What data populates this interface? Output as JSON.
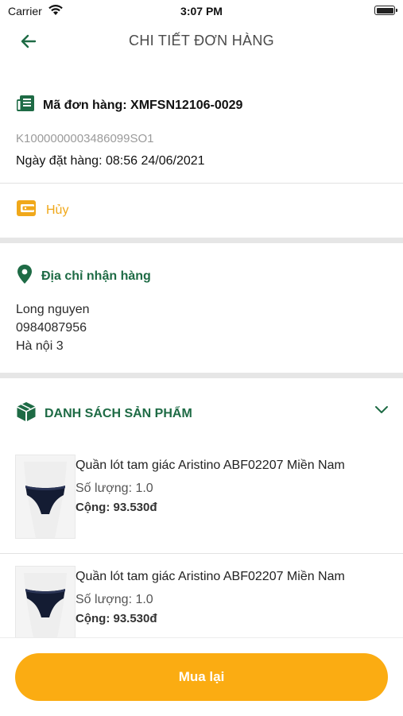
{
  "status_bar": {
    "carrier": "Carrier",
    "time": "3:07 PM"
  },
  "header": {
    "title": "CHI TIẾT ĐƠN HÀNG"
  },
  "order": {
    "code_label": "Mã đơn hàng: XMFSN12106-0029",
    "sub_code": "K1000000003486099SO1",
    "date_label": "Ngày đặt hàng: 08:56 24/06/2021",
    "status": "Hủy",
    "status_color": "#f0a81a"
  },
  "address": {
    "title": "Địa chỉ nhận hàng",
    "name": "Long nguyen",
    "phone": "0984087956",
    "line": "Hà nội 3"
  },
  "products": {
    "title": "DANH SÁCH SẢN PHẨM",
    "items": [
      {
        "name": "Quần lót tam giác Aristino ABF02207 Miền Nam",
        "qty": "Số lượng: 1.0",
        "total": "Cộng: 93.530đ"
      },
      {
        "name": "Quần lót tam giác Aristino ABF02207 Miền Nam",
        "qty": "Số lượng: 1.0",
        "total": "Cộng: 93.530đ"
      }
    ]
  },
  "footer": {
    "buy_again": "Mua lại"
  },
  "colors": {
    "brand_green": "#1e6b45",
    "accent_orange": "#fbac12",
    "warn": "#f0a81a"
  },
  "icons": [
    "back-arrow-icon",
    "receipt-icon",
    "wallet-icon",
    "location-pin-icon",
    "package-icon",
    "chevron-down-icon",
    "wifi-icon",
    "battery-icon"
  ]
}
